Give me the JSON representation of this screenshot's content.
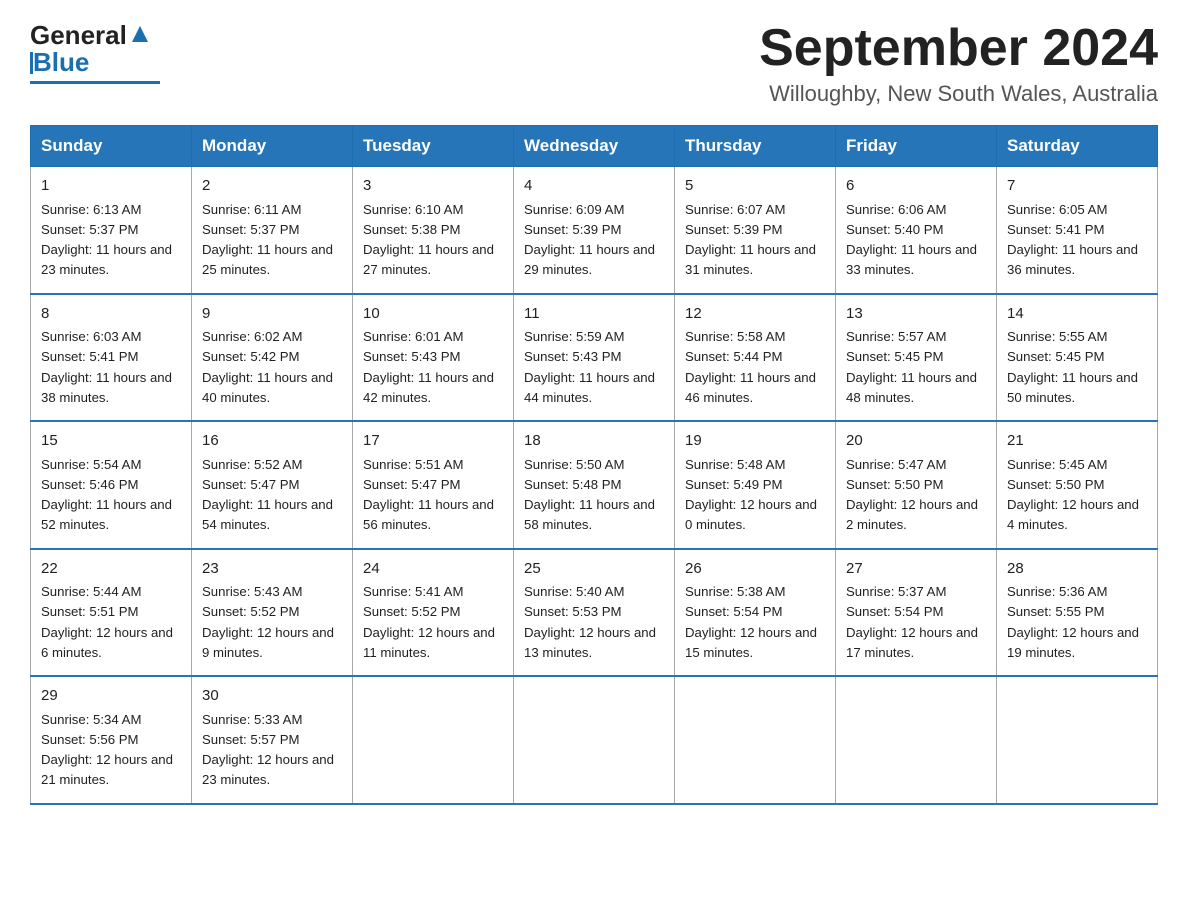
{
  "header": {
    "logo": {
      "general": "General",
      "blue": "Blue"
    },
    "title": "September 2024",
    "location": "Willoughby, New South Wales, Australia"
  },
  "days_of_week": [
    "Sunday",
    "Monday",
    "Tuesday",
    "Wednesday",
    "Thursday",
    "Friday",
    "Saturday"
  ],
  "weeks": [
    [
      {
        "day": 1,
        "sunrise": "6:13 AM",
        "sunset": "5:37 PM",
        "daylight": "11 hours and 23 minutes."
      },
      {
        "day": 2,
        "sunrise": "6:11 AM",
        "sunset": "5:37 PM",
        "daylight": "11 hours and 25 minutes."
      },
      {
        "day": 3,
        "sunrise": "6:10 AM",
        "sunset": "5:38 PM",
        "daylight": "11 hours and 27 minutes."
      },
      {
        "day": 4,
        "sunrise": "6:09 AM",
        "sunset": "5:39 PM",
        "daylight": "11 hours and 29 minutes."
      },
      {
        "day": 5,
        "sunrise": "6:07 AM",
        "sunset": "5:39 PM",
        "daylight": "11 hours and 31 minutes."
      },
      {
        "day": 6,
        "sunrise": "6:06 AM",
        "sunset": "5:40 PM",
        "daylight": "11 hours and 33 minutes."
      },
      {
        "day": 7,
        "sunrise": "6:05 AM",
        "sunset": "5:41 PM",
        "daylight": "11 hours and 36 minutes."
      }
    ],
    [
      {
        "day": 8,
        "sunrise": "6:03 AM",
        "sunset": "5:41 PM",
        "daylight": "11 hours and 38 minutes."
      },
      {
        "day": 9,
        "sunrise": "6:02 AM",
        "sunset": "5:42 PM",
        "daylight": "11 hours and 40 minutes."
      },
      {
        "day": 10,
        "sunrise": "6:01 AM",
        "sunset": "5:43 PM",
        "daylight": "11 hours and 42 minutes."
      },
      {
        "day": 11,
        "sunrise": "5:59 AM",
        "sunset": "5:43 PM",
        "daylight": "11 hours and 44 minutes."
      },
      {
        "day": 12,
        "sunrise": "5:58 AM",
        "sunset": "5:44 PM",
        "daylight": "11 hours and 46 minutes."
      },
      {
        "day": 13,
        "sunrise": "5:57 AM",
        "sunset": "5:45 PM",
        "daylight": "11 hours and 48 minutes."
      },
      {
        "day": 14,
        "sunrise": "5:55 AM",
        "sunset": "5:45 PM",
        "daylight": "11 hours and 50 minutes."
      }
    ],
    [
      {
        "day": 15,
        "sunrise": "5:54 AM",
        "sunset": "5:46 PM",
        "daylight": "11 hours and 52 minutes."
      },
      {
        "day": 16,
        "sunrise": "5:52 AM",
        "sunset": "5:47 PM",
        "daylight": "11 hours and 54 minutes."
      },
      {
        "day": 17,
        "sunrise": "5:51 AM",
        "sunset": "5:47 PM",
        "daylight": "11 hours and 56 minutes."
      },
      {
        "day": 18,
        "sunrise": "5:50 AM",
        "sunset": "5:48 PM",
        "daylight": "11 hours and 58 minutes."
      },
      {
        "day": 19,
        "sunrise": "5:48 AM",
        "sunset": "5:49 PM",
        "daylight": "12 hours and 0 minutes."
      },
      {
        "day": 20,
        "sunrise": "5:47 AM",
        "sunset": "5:50 PM",
        "daylight": "12 hours and 2 minutes."
      },
      {
        "day": 21,
        "sunrise": "5:45 AM",
        "sunset": "5:50 PM",
        "daylight": "12 hours and 4 minutes."
      }
    ],
    [
      {
        "day": 22,
        "sunrise": "5:44 AM",
        "sunset": "5:51 PM",
        "daylight": "12 hours and 6 minutes."
      },
      {
        "day": 23,
        "sunrise": "5:43 AM",
        "sunset": "5:52 PM",
        "daylight": "12 hours and 9 minutes."
      },
      {
        "day": 24,
        "sunrise": "5:41 AM",
        "sunset": "5:52 PM",
        "daylight": "12 hours and 11 minutes."
      },
      {
        "day": 25,
        "sunrise": "5:40 AM",
        "sunset": "5:53 PM",
        "daylight": "12 hours and 13 minutes."
      },
      {
        "day": 26,
        "sunrise": "5:38 AM",
        "sunset": "5:54 PM",
        "daylight": "12 hours and 15 minutes."
      },
      {
        "day": 27,
        "sunrise": "5:37 AM",
        "sunset": "5:54 PM",
        "daylight": "12 hours and 17 minutes."
      },
      {
        "day": 28,
        "sunrise": "5:36 AM",
        "sunset": "5:55 PM",
        "daylight": "12 hours and 19 minutes."
      }
    ],
    [
      {
        "day": 29,
        "sunrise": "5:34 AM",
        "sunset": "5:56 PM",
        "daylight": "12 hours and 21 minutes."
      },
      {
        "day": 30,
        "sunrise": "5:33 AM",
        "sunset": "5:57 PM",
        "daylight": "12 hours and 23 minutes."
      },
      null,
      null,
      null,
      null,
      null
    ]
  ],
  "labels": {
    "sunrise": "Sunrise:",
    "sunset": "Sunset:",
    "daylight": "Daylight:"
  }
}
